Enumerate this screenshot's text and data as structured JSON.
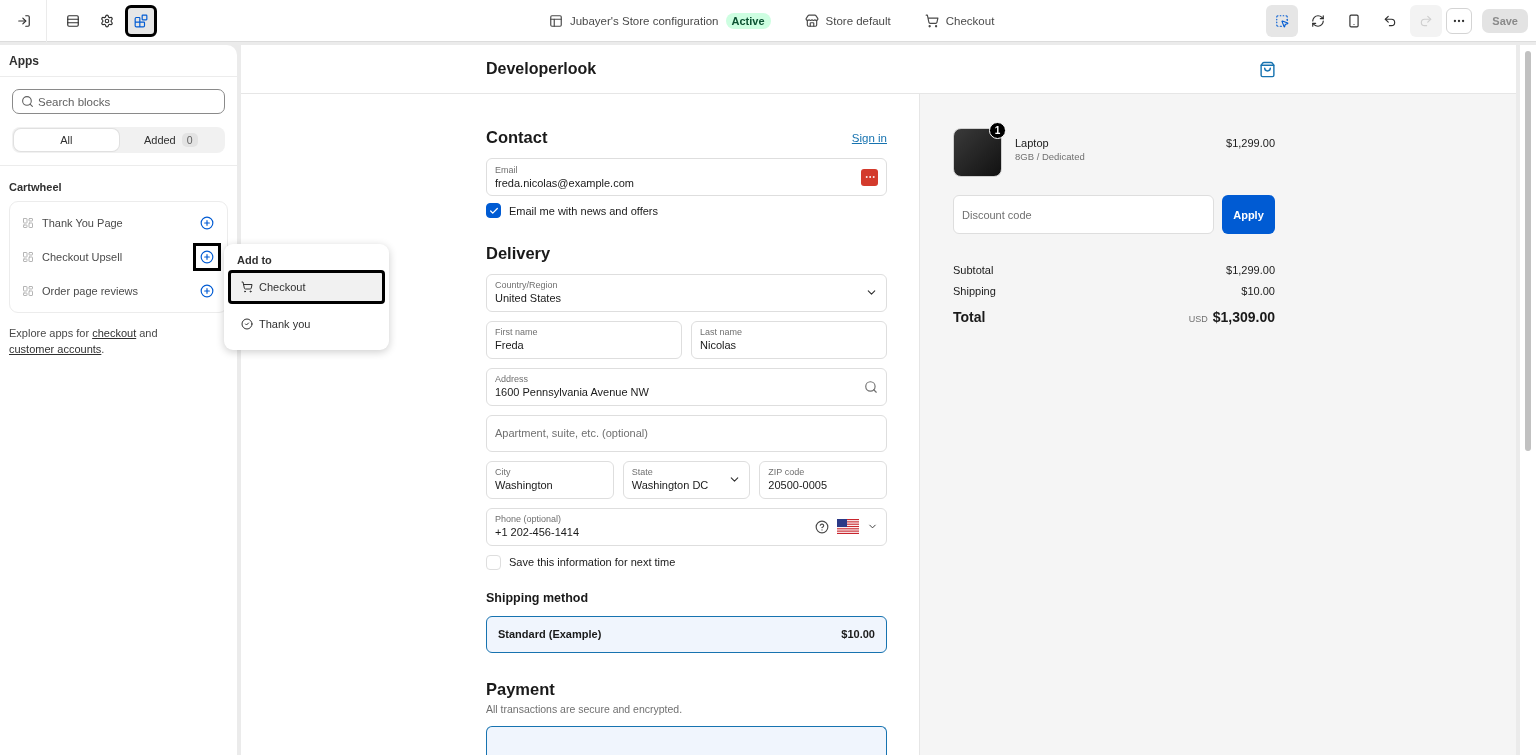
{
  "topbar": {
    "left_tools": [
      {
        "kind": "exit",
        "selected": false,
        "highlighted": false
      },
      {
        "kind": "sections",
        "selected": false,
        "highlighted": false
      },
      {
        "kind": "settings",
        "selected": false,
        "highlighted": false
      },
      {
        "kind": "apps",
        "selected": true,
        "highlighted": true
      }
    ],
    "context": [
      {
        "kind": "config",
        "label": "Jubayer's Store configuration",
        "badge": "Active"
      },
      {
        "kind": "store",
        "label": "Store default"
      },
      {
        "kind": "cart",
        "label": "Checkout"
      }
    ],
    "right_tools": [
      {
        "kind": "inspector",
        "selected": true,
        "disabled": false
      },
      {
        "kind": "refresh",
        "selected": false,
        "disabled": false
      },
      {
        "kind": "mobile",
        "selected": false,
        "disabled": false
      },
      {
        "kind": "undo",
        "selected": false,
        "disabled": false
      },
      {
        "kind": "redo",
        "selected": false,
        "disabled": true
      },
      {
        "kind": "more",
        "selected": false,
        "disabled": false
      }
    ],
    "save_button": {
      "label": "Save",
      "disabled": true
    }
  },
  "sidebar": {
    "title": "Apps",
    "search": {
      "placeholder": "Search blocks"
    },
    "filters": [
      {
        "label": "All",
        "selected": true
      },
      {
        "label": "Added",
        "count": "0",
        "selected": false
      }
    ],
    "section": "Cartwheel",
    "items": [
      {
        "label": "Thank You Page",
        "highlighted": false
      },
      {
        "label": "Checkout Upsell",
        "highlighted": true
      },
      {
        "label": "Order page reviews",
        "highlighted": false
      }
    ],
    "footer": [
      {
        "kind": "text",
        "text": "Explore apps for "
      },
      {
        "kind": "link",
        "text": "checkout"
      },
      {
        "kind": "text",
        "text": " and "
      },
      {
        "kind": "link",
        "text": "customer accounts"
      },
      {
        "kind": "text",
        "text": "."
      }
    ]
  },
  "popup": {
    "title": "Add to",
    "items": [
      {
        "kind": "cart",
        "label": "Checkout",
        "selected": true,
        "highlighted": true
      },
      {
        "kind": "check",
        "label": "Thank you",
        "selected": false,
        "highlighted": false
      }
    ]
  },
  "preview": {
    "store_name": "Developerlook",
    "contact": {
      "heading": "Contact",
      "link": "Sign in",
      "email": {
        "label": "Email",
        "value": "freda.nicolas@example.com"
      },
      "newsletter": {
        "label": "Email me with news and offers",
        "checked": true
      }
    },
    "delivery": {
      "heading": "Delivery",
      "rows": [
        [
          {
            "kind": "select",
            "label": "Country/Region",
            "value": "United States"
          }
        ],
        [
          {
            "kind": "text",
            "label": "First name",
            "value": "Freda"
          },
          {
            "kind": "text",
            "label": "Last name",
            "value": "Nicolas"
          }
        ],
        [
          {
            "kind": "search",
            "label": "Address",
            "value": "1600 Pennsylvania Avenue NW"
          }
        ],
        [
          {
            "kind": "placeholder",
            "placeholder": "Apartment, suite, etc. (optional)"
          }
        ],
        [
          {
            "kind": "text",
            "label": "City",
            "value": "Washington"
          },
          {
            "kind": "select",
            "label": "State",
            "value": "Washington DC"
          },
          {
            "kind": "text",
            "label": "ZIP code",
            "value": "20500-0005"
          }
        ],
        [
          {
            "kind": "phone",
            "label": "Phone (optional)",
            "value": "+1 202-456-1414"
          }
        ]
      ],
      "save": {
        "label": "Save this information for next time",
        "checked": false
      }
    },
    "shipping": {
      "heading": "Shipping method",
      "option": {
        "label": "Standard (Example)",
        "price": "$10.00",
        "selected": true
      }
    },
    "payment": {
      "heading": "Payment",
      "subtitle": "All transactions are secure and encrypted."
    }
  },
  "summary": {
    "items": [
      {
        "name": "Laptop",
        "variant": "8GB / Dedicated",
        "price": "$1,299.00",
        "quantity": "1"
      }
    ],
    "discount": {
      "placeholder": "Discount code",
      "button": "Apply"
    },
    "lines": [
      {
        "label": "Subtotal",
        "value": "$1,299.00"
      },
      {
        "label": "Shipping",
        "value": "$10.00"
      }
    ],
    "total": {
      "label": "Total",
      "currency": "USD",
      "value": "$1,309.00"
    }
  }
}
